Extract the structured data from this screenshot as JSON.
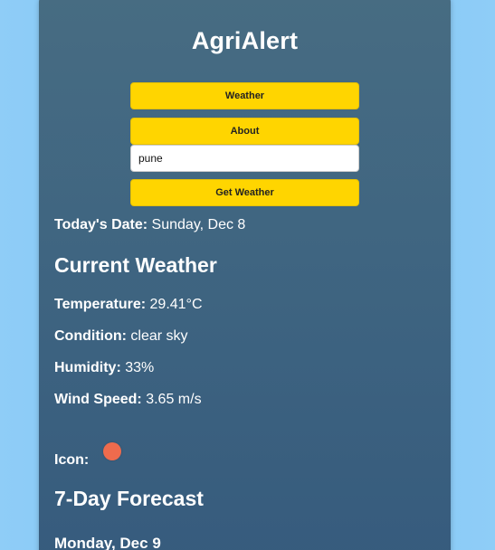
{
  "app": {
    "title": "AgriAlert"
  },
  "nav": {
    "weather_label": "Weather",
    "about_label": "About"
  },
  "search": {
    "value": "pune",
    "button_label": "Get Weather"
  },
  "date": {
    "label": "Today's Date:",
    "value": "Sunday, Dec 8"
  },
  "current": {
    "heading": "Current Weather",
    "temperature_label": "Temperature:",
    "temperature_value": "29.41°C",
    "condition_label": "Condition:",
    "condition_value": "clear sky",
    "humidity_label": "Humidity:",
    "humidity_value": "33%",
    "wind_label": "Wind Speed:",
    "wind_value": "3.65 m/s",
    "icon_label": "Icon:",
    "icon_name": "sun-icon",
    "icon_color": "#ee6b4d"
  },
  "forecast": {
    "heading": "7-Day Forecast",
    "days": [
      {
        "label": "Monday, Dec 9"
      }
    ]
  },
  "colors": {
    "button": "#ffd500",
    "card": "#3f6581",
    "background": "#8fcdf7"
  }
}
